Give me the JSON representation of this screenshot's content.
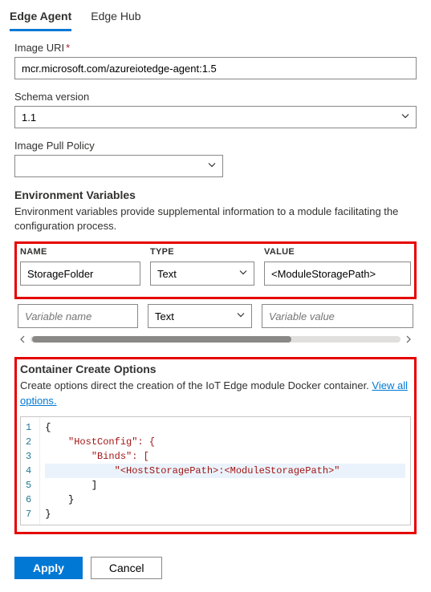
{
  "tabs": {
    "edge_agent": "Edge Agent",
    "edge_hub": "Edge Hub"
  },
  "fields": {
    "image_uri": {
      "label": "Image URI",
      "required": "*",
      "value": "mcr.microsoft.com/azureiotedge-agent:1.5"
    },
    "schema_version": {
      "label": "Schema version",
      "value": "1.1"
    },
    "image_pull_policy": {
      "label": "Image Pull Policy",
      "value": ""
    }
  },
  "env": {
    "title": "Environment Variables",
    "desc": "Environment variables provide supplemental information to a module facilitating the configuration process.",
    "headers": {
      "name": "NAME",
      "type": "TYPE",
      "value": "VALUE"
    },
    "rows": [
      {
        "name": "StorageFolder",
        "type": "Text",
        "value": "<ModuleStoragePath>"
      }
    ],
    "placeholder_row": {
      "name": "Variable name",
      "type": "Text",
      "value": "Variable value"
    }
  },
  "create_opts": {
    "title": "Container Create Options",
    "desc_prefix": "Create options direct the creation of the IoT Edge module Docker container. ",
    "link": "View all options.",
    "lines": [
      "{",
      "    \"HostConfig\": {",
      "        \"Binds\": [",
      "            \"<HostStoragePath>:<ModuleStoragePath>\"",
      "        ]",
      "    }",
      "}"
    ]
  },
  "buttons": {
    "apply": "Apply",
    "cancel": "Cancel"
  }
}
